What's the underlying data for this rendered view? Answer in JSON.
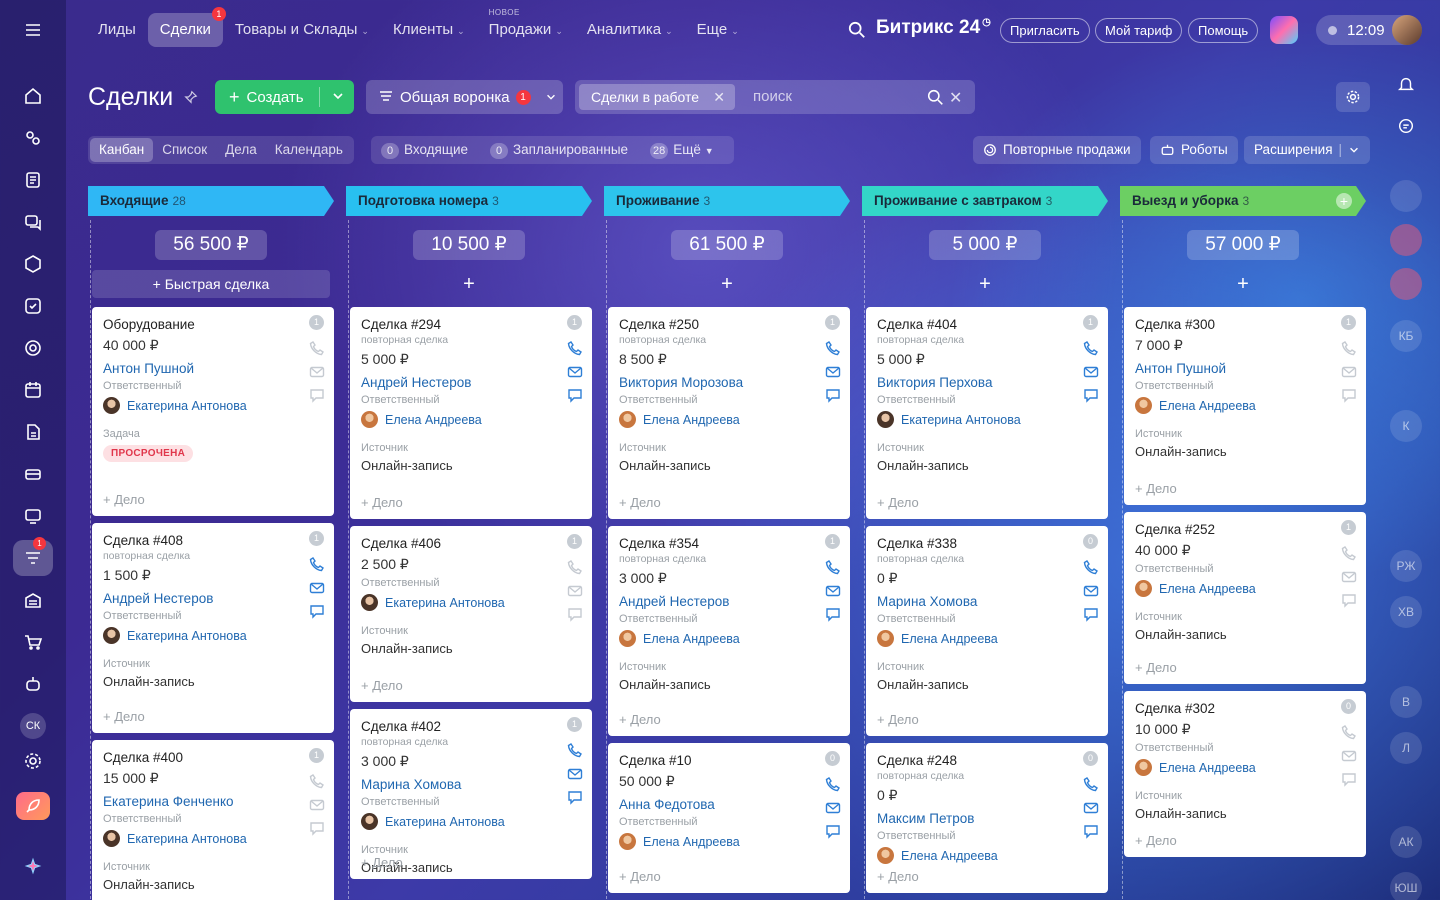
{
  "topnav": {
    "items": [
      {
        "label": "Лиды",
        "active": false,
        "caret": false
      },
      {
        "label": "Сделки",
        "active": true,
        "badge": "1",
        "caret": false
      },
      {
        "label": "Товары и Склады",
        "caret": true
      },
      {
        "label": "Клиенты",
        "caret": true
      },
      {
        "label": "Продажи",
        "caret": true,
        "tag": "НОВОЕ"
      },
      {
        "label": "Аналитика",
        "caret": true
      },
      {
        "label": "Еще",
        "caret": true
      }
    ],
    "brand": "Битрикс 24",
    "invite": "Пригласить",
    "tariff": "Мой тариф",
    "help": "Помощь",
    "time": "12:09"
  },
  "toolbar": {
    "title": "Сделки",
    "create_label": "Создать",
    "funnel_label": "Общая воронка",
    "funnel_badge": "1",
    "filter_chip": "Сделки в работе",
    "search_placeholder": "поиск"
  },
  "views": [
    "Канбан",
    "Список",
    "Дела",
    "Календарь"
  ],
  "counters": {
    "incoming_count": "0",
    "incoming_label": "Входящие",
    "planned_count": "0",
    "planned_label": "Запланированные",
    "more_count": "28",
    "more_label": "Ещё"
  },
  "actions": {
    "repeat": "Повторные продажи",
    "robots": "Роботы",
    "extensions": "Расширения"
  },
  "labels": {
    "responsible": "Ответственный",
    "source": "Источник",
    "add_deal": "+ Дело",
    "repeat_deal": "повторная сделка",
    "task": "Задача",
    "overdue": "ПРОСРОЧЕНА",
    "quick_deal": "Быстрая сделка"
  },
  "colors": {
    "col1": "#2fb7f5",
    "col2": "#28c0f0",
    "col3": "#2dc4ec",
    "col4": "#33d6c8",
    "col5": "#6ccf63",
    "accent_green": "#2fc26e",
    "link": "#2067b0",
    "badge_red": "#f5363f"
  },
  "columns": [
    {
      "title": "Входящие",
      "count": "28",
      "sum": "56 500 ₽",
      "cards": [
        {
          "title": "Оборудование",
          "amount": "40 000 ₽",
          "client": "Антон Пушной",
          "resp": "Екатерина Антонова",
          "num": "1",
          "task": true
        },
        {
          "title": "Сделка #408",
          "repeat": true,
          "amount": "1 500 ₽",
          "client": "Андрей Нестеров",
          "resp": "Екатерина Антонова",
          "num": "1",
          "source": "Онлайн-запись"
        },
        {
          "title": "Сделка #400",
          "amount": "15 000 ₽",
          "client": "Екатерина Фенченко",
          "resp": "Екатерина Антонова",
          "num": "1",
          "source": "Онлайн-запись"
        }
      ]
    },
    {
      "title": "Подготовка номера",
      "count": "3",
      "sum": "10 500 ₽",
      "cards": [
        {
          "title": "Сделка #294",
          "repeat": true,
          "amount": "5 000 ₽",
          "client": "Андрей Нестеров",
          "resp": "Елена Андреева",
          "num": "1",
          "source": "Онлайн-запись"
        },
        {
          "title": "Сделка #406",
          "amount": "2 500 ₽",
          "resp": "Екатерина Антонова",
          "num": "1",
          "source": "Онлайн-запись"
        },
        {
          "title": "Сделка #402",
          "repeat": true,
          "amount": "3 000 ₽",
          "client": "Марина Хомова",
          "resp": "Екатерина Антонова",
          "num": "1",
          "source": "Онлайн-запись"
        }
      ]
    },
    {
      "title": "Проживание",
      "count": "3",
      "sum": "61 500 ₽",
      "cards": [
        {
          "title": "Сделка #250",
          "repeat": true,
          "amount": "8 500 ₽",
          "client": "Виктория Морозова",
          "resp": "Елена Андреева",
          "num": "1",
          "source": "Онлайн-запись"
        },
        {
          "title": "Сделка #354",
          "repeat": true,
          "amount": "3 000 ₽",
          "client": "Андрей Нестеров",
          "resp": "Елена Андреева",
          "num": "1",
          "source": "Онлайн-запись"
        },
        {
          "title": "Сделка #10",
          "amount": "50 000 ₽",
          "client": "Анна Федотова",
          "resp": "Елена Андреева",
          "num": "0"
        }
      ]
    },
    {
      "title": "Проживание с завтраком",
      "count": "3",
      "sum": "5 000 ₽",
      "cards": [
        {
          "title": "Сделка #404",
          "repeat": true,
          "amount": "5 000 ₽",
          "client": "Виктория Перхова",
          "resp": "Екатерина Антонова",
          "num": "1",
          "source": "Онлайн-запись"
        },
        {
          "title": "Сделка #338",
          "repeat": true,
          "amount": "0 ₽",
          "client": "Марина Хомова",
          "resp": "Елена Андреева",
          "num": "0",
          "source": "Онлайн-запись"
        },
        {
          "title": "Сделка #248",
          "repeat": true,
          "amount": "0 ₽",
          "client": "Максим Петров",
          "resp": "Елена Андреева",
          "num": "0"
        }
      ]
    },
    {
      "title": "Выезд и уборка",
      "count": "3",
      "sum": "57 000 ₽",
      "cards": [
        {
          "title": "Сделка #300",
          "amount": "7 000 ₽",
          "client": "Антон Пушной",
          "resp": "Елена Андреева",
          "num": "1",
          "source": "Онлайн-запись"
        },
        {
          "title": "Сделка #252",
          "amount": "40 000 ₽",
          "resp": "Елена Андреева",
          "num": "1",
          "source": "Онлайн-запись"
        },
        {
          "title": "Сделка #302",
          "amount": "10 000 ₽",
          "resp": "Елена Андреева",
          "num": "0",
          "source": "Онлайн-запись"
        }
      ]
    }
  ],
  "sidebar_texts": {
    "sk": "СК"
  },
  "rail_texts": [
    "КБ",
    "К",
    "РЖ",
    "ХВ",
    "В",
    "Л",
    "АК",
    "ЮШ"
  ]
}
